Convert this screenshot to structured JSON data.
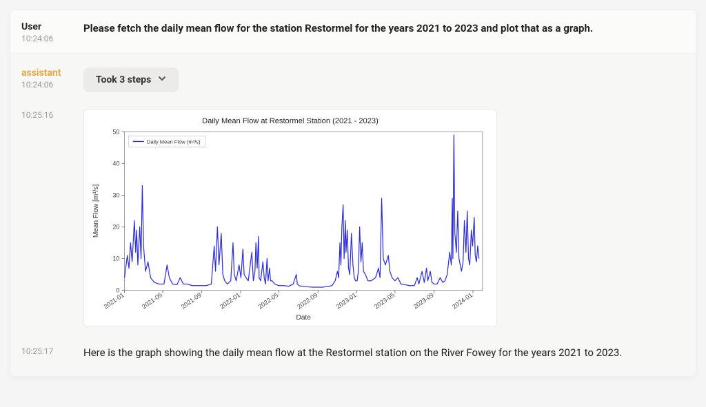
{
  "messages": {
    "user": {
      "role": "User",
      "timestamp": "10:24:06",
      "text": "Please fetch the daily mean flow for the station Restormel for the years 2021 to 2023 and plot that as a graph."
    },
    "assistant_steps": {
      "role": "assistant",
      "timestamp": "10:24:06",
      "steps_label": "Took 3 steps"
    },
    "assistant_chart": {
      "timestamp": "10:25:16"
    },
    "assistant_text": {
      "timestamp": "10:25:17",
      "text": "Here is the graph showing the daily mean flow at the Restormel station on the River Fowey for the years 2021 to 2023."
    }
  },
  "chart_data": {
    "type": "line",
    "title": "Daily Mean Flow at Restormel Station (2021 - 2023)",
    "legend": [
      "Daily Mean Flow (m³/s)"
    ],
    "xlabel": "Date",
    "ylabel": "Mean Flow [m³/s]",
    "xticks": [
      "2021-01",
      "2021-05",
      "2021-09",
      "2022-01",
      "2022-05",
      "2022-09",
      "2023-01",
      "2023-05",
      "2023-09",
      "2024-01"
    ],
    "ylim": [
      0,
      50
    ],
    "yticks": [
      0,
      10,
      20,
      30,
      40,
      50
    ],
    "x_start": "2021-01-01",
    "x_end": "2024-01-31",
    "series": [
      {
        "name": "Daily Mean Flow (m³/s)",
        "color": "#2b2bd9",
        "values": [
          [
            "2021-01-01",
            4
          ],
          [
            "2021-01-10",
            11
          ],
          [
            "2021-01-15",
            7
          ],
          [
            "2021-01-20",
            15
          ],
          [
            "2021-01-25",
            9
          ],
          [
            "2021-02-01",
            22
          ],
          [
            "2021-02-05",
            12
          ],
          [
            "2021-02-08",
            19
          ],
          [
            "2021-02-12",
            8
          ],
          [
            "2021-02-18",
            20
          ],
          [
            "2021-02-22",
            10
          ],
          [
            "2021-02-26",
            33
          ],
          [
            "2021-03-02",
            14
          ],
          [
            "2021-03-08",
            6
          ],
          [
            "2021-03-16",
            9
          ],
          [
            "2021-03-24",
            4
          ],
          [
            "2021-04-05",
            2.5
          ],
          [
            "2021-04-20",
            2
          ],
          [
            "2021-05-05",
            2
          ],
          [
            "2021-05-15",
            8
          ],
          [
            "2021-05-22",
            4
          ],
          [
            "2021-06-01",
            2
          ],
          [
            "2021-06-15",
            1.8
          ],
          [
            "2021-06-25",
            4
          ],
          [
            "2021-07-05",
            2
          ],
          [
            "2021-07-18",
            2
          ],
          [
            "2021-08-01",
            1.5
          ],
          [
            "2021-08-15",
            1.5
          ],
          [
            "2021-09-01",
            1.5
          ],
          [
            "2021-09-15",
            1.5
          ],
          [
            "2021-10-01",
            2
          ],
          [
            "2021-10-10",
            14
          ],
          [
            "2021-10-14",
            6
          ],
          [
            "2021-10-20",
            20
          ],
          [
            "2021-10-25",
            8
          ],
          [
            "2021-11-01",
            18
          ],
          [
            "2021-11-06",
            5
          ],
          [
            "2021-11-12",
            3
          ],
          [
            "2021-11-20",
            2
          ],
          [
            "2021-12-01",
            3
          ],
          [
            "2021-12-08",
            15
          ],
          [
            "2021-12-12",
            5
          ],
          [
            "2021-12-18",
            3
          ],
          [
            "2021-12-27",
            8
          ],
          [
            "2022-01-02",
            4
          ],
          [
            "2022-01-08",
            13
          ],
          [
            "2022-01-12",
            5
          ],
          [
            "2022-01-18",
            4
          ],
          [
            "2022-01-25",
            3
          ],
          [
            "2022-02-05",
            12
          ],
          [
            "2022-02-10",
            3
          ],
          [
            "2022-02-15",
            6
          ],
          [
            "2022-02-18",
            15
          ],
          [
            "2022-02-22",
            7
          ],
          [
            "2022-02-26",
            17
          ],
          [
            "2022-02-28",
            4
          ],
          [
            "2022-03-05",
            3
          ],
          [
            "2022-03-12",
            9
          ],
          [
            "2022-03-16",
            4
          ],
          [
            "2022-03-20",
            2
          ],
          [
            "2022-03-25",
            10
          ],
          [
            "2022-03-28",
            3
          ],
          [
            "2022-04-02",
            7
          ],
          [
            "2022-04-05",
            3
          ],
          [
            "2022-04-10",
            3
          ],
          [
            "2022-04-18",
            2
          ],
          [
            "2022-05-01",
            1.5
          ],
          [
            "2022-05-15",
            1.5
          ],
          [
            "2022-06-01",
            1.3
          ],
          [
            "2022-06-15",
            2
          ],
          [
            "2022-06-25",
            5
          ],
          [
            "2022-06-28",
            2
          ],
          [
            "2022-07-05",
            1.4
          ],
          [
            "2022-07-20",
            1.2
          ],
          [
            "2022-08-01",
            1.1
          ],
          [
            "2022-08-15",
            1
          ],
          [
            "2022-09-01",
            1
          ],
          [
            "2022-09-15",
            1
          ],
          [
            "2022-10-01",
            1.2
          ],
          [
            "2022-10-15",
            1.5
          ],
          [
            "2022-10-25",
            3
          ],
          [
            "2022-11-01",
            6
          ],
          [
            "2022-11-05",
            4
          ],
          [
            "2022-11-09",
            15
          ],
          [
            "2022-11-12",
            8
          ],
          [
            "2022-11-15",
            20
          ],
          [
            "2022-11-19",
            27
          ],
          [
            "2022-11-22",
            10
          ],
          [
            "2022-11-26",
            22
          ],
          [
            "2022-11-28",
            12
          ],
          [
            "2022-12-02",
            19
          ],
          [
            "2022-12-06",
            7
          ],
          [
            "2022-12-10",
            5
          ],
          [
            "2022-12-15",
            18
          ],
          [
            "2022-12-20",
            8
          ],
          [
            "2022-12-24",
            4
          ],
          [
            "2022-12-28",
            3
          ],
          [
            "2023-01-02",
            3
          ],
          [
            "2023-01-06",
            6
          ],
          [
            "2023-01-10",
            20
          ],
          [
            "2023-01-14",
            9
          ],
          [
            "2023-01-18",
            15
          ],
          [
            "2023-01-22",
            6
          ],
          [
            "2023-01-28",
            5
          ],
          [
            "2023-02-05",
            3
          ],
          [
            "2023-02-15",
            3
          ],
          [
            "2023-03-01",
            4
          ],
          [
            "2023-03-10",
            7
          ],
          [
            "2023-03-15",
            4
          ],
          [
            "2023-03-20",
            29
          ],
          [
            "2023-03-25",
            10
          ],
          [
            "2023-04-01",
            8
          ],
          [
            "2023-04-10",
            11
          ],
          [
            "2023-04-15",
            6
          ],
          [
            "2023-04-22",
            4
          ],
          [
            "2023-05-01",
            3
          ],
          [
            "2023-05-10",
            4
          ],
          [
            "2023-05-20",
            2
          ],
          [
            "2023-06-01",
            1.8
          ],
          [
            "2023-06-15",
            1.5
          ],
          [
            "2023-07-01",
            1.5
          ],
          [
            "2023-07-10",
            4
          ],
          [
            "2023-07-15",
            2
          ],
          [
            "2023-07-25",
            6
          ],
          [
            "2023-08-01",
            2.5
          ],
          [
            "2023-08-08",
            7
          ],
          [
            "2023-08-12",
            3
          ],
          [
            "2023-08-20",
            6
          ],
          [
            "2023-08-25",
            2.5
          ],
          [
            "2023-09-01",
            2
          ],
          [
            "2023-09-10",
            2
          ],
          [
            "2023-09-20",
            4
          ],
          [
            "2023-09-28",
            2.5
          ],
          [
            "2023-10-05",
            3
          ],
          [
            "2023-10-12",
            5
          ],
          [
            "2023-10-20",
            12
          ],
          [
            "2023-10-25",
            8
          ],
          [
            "2023-10-28",
            29
          ],
          [
            "2023-10-30",
            10
          ],
          [
            "2023-11-02",
            49
          ],
          [
            "2023-11-05",
            18
          ],
          [
            "2023-11-10",
            12
          ],
          [
            "2023-11-14",
            25
          ],
          [
            "2023-11-18",
            10
          ],
          [
            "2023-11-22",
            8
          ],
          [
            "2023-11-26",
            6
          ],
          [
            "2023-12-01",
            9
          ],
          [
            "2023-12-05",
            22
          ],
          [
            "2023-12-10",
            12
          ],
          [
            "2023-12-14",
            25
          ],
          [
            "2023-12-18",
            10
          ],
          [
            "2023-12-22",
            8
          ],
          [
            "2023-12-27",
            19
          ],
          [
            "2023-12-31",
            14
          ],
          [
            "2024-01-05",
            23
          ],
          [
            "2024-01-08",
            11
          ],
          [
            "2024-01-12",
            9
          ],
          [
            "2024-01-16",
            14
          ],
          [
            "2024-01-20",
            10
          ]
        ]
      }
    ]
  }
}
